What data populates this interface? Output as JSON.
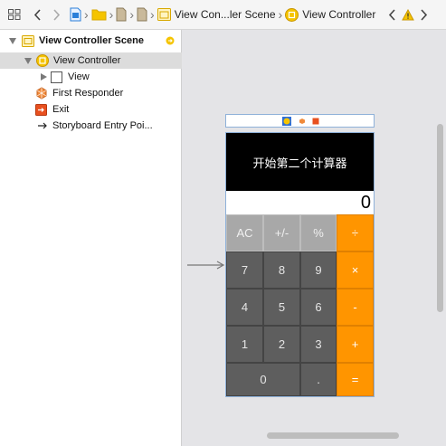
{
  "jump_bar": {
    "crumbs": [
      "View Con...ler Scene",
      "View Controller"
    ],
    "colors": {
      "accent": "#f5c400",
      "folder": "#f5c400",
      "file": "#2b7fd9"
    }
  },
  "outline": {
    "items": [
      {
        "label": "View Controller Scene"
      },
      {
        "label": "View Controller"
      },
      {
        "label": "View"
      },
      {
        "label": "First Responder"
      },
      {
        "label": "Exit"
      },
      {
        "label": "Storyboard Entry Poi..."
      }
    ]
  },
  "calculator": {
    "title": "开始第二个计算器",
    "display_value": "0",
    "keys": [
      "AC",
      "+/-",
      "%",
      "÷",
      "7",
      "8",
      "9",
      "×",
      "4",
      "5",
      "6",
      "-",
      "1",
      "2",
      "3",
      "+",
      "0",
      ".",
      "="
    ],
    "colors": {
      "function": "#a8a8a8",
      "number": "#5e5e5e",
      "operator": "#ff9500",
      "header": "#000000"
    }
  }
}
